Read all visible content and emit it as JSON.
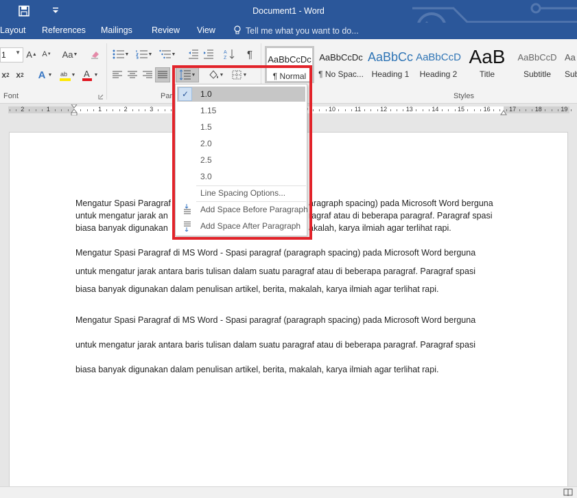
{
  "app": {
    "title": "Document1 - Word"
  },
  "tabs": [
    {
      "label": "Layout"
    },
    {
      "label": "References"
    },
    {
      "label": "Mailings"
    },
    {
      "label": "Review"
    },
    {
      "label": "View"
    }
  ],
  "tell_me": {
    "placeholder": "Tell me what you want to do..."
  },
  "ribbon": {
    "font_size": "1",
    "font_group_label": "Font",
    "paragraph_group_label": "Para",
    "styles_group_label": "Styles",
    "styles": [
      {
        "preview": "AaBbCcDc",
        "name": "¶ Normal"
      },
      {
        "preview": "AaBbCcDc",
        "name": "¶ No Spac..."
      },
      {
        "preview": "AaBbCc",
        "name": "Heading 1"
      },
      {
        "preview": "AaBbCcD",
        "name": "Heading 2"
      },
      {
        "preview": "AaB",
        "name": "Title"
      },
      {
        "preview": "AaBbCcD",
        "name": "Subtitle"
      },
      {
        "preview": "Aa",
        "name": "Sub"
      }
    ],
    "colors": {
      "brand": "#2b579a",
      "highlight_yellow": "#ffe800",
      "font_red": "#e0141e",
      "accent_red": "#e2232a"
    }
  },
  "ruler": {
    "left_numbers": [
      "2",
      "1"
    ],
    "right_numbers": [
      "1",
      "2",
      "3",
      "4",
      "5",
      "6",
      "7",
      "8",
      "9",
      "10",
      "11",
      "12",
      "13",
      "14",
      "15",
      "16",
      "17",
      "18",
      "19"
    ]
  },
  "line_spacing_menu": {
    "options": [
      "1.0",
      "1.15",
      "1.5",
      "2.0",
      "2.5",
      "3.0"
    ],
    "selected": "1.0",
    "spacing_options_label": "Line Spacing Options...",
    "add_before_label": "Add Space Before Paragraph",
    "add_after_label": "Add Space After Paragraph"
  },
  "document": {
    "para1": {
      "line1_left": "Mengatur Spasi Paragraf",
      "line1_right": "aragraph spacing) pada Microsoft Word berguna",
      "line2_left": "untuk mengatur jarak an",
      "line2_right": "ragraf atau di beberapa paragraf. Paragraf spasi",
      "line3_left": "biasa banyak digunakan",
      "line3_right": "akalah, karya ilmiah agar terlihat rapi."
    },
    "para2": {
      "line1": "Mengatur Spasi Paragraf di MS Word - Spasi paragraf (paragraph spacing) pada Microsoft Word berguna",
      "line2": "untuk mengatur jarak antara baris tulisan dalam suatu paragraf atau di beberapa paragraf. Paragraf spasi",
      "line3": "biasa banyak digunakan dalam penulisan artikel, berita, makalah, karya ilmiah agar terlihat rapi."
    },
    "para3": {
      "line1": "Mengatur Spasi Paragraf di MS Word - Spasi paragraf (paragraph spacing) pada Microsoft Word berguna",
      "line2": "untuk mengatur jarak antara baris tulisan dalam suatu paragraf atau di beberapa paragraf. Paragraf spasi",
      "line3": "biasa banyak digunakan dalam penulisan artikel, berita, makalah, karya ilmiah agar terlihat rapi."
    }
  }
}
